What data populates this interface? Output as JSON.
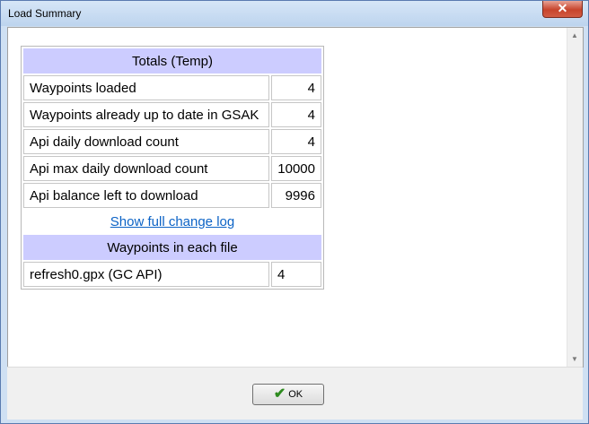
{
  "window": {
    "title": "Load Summary",
    "close_glyph": "✕"
  },
  "totals": {
    "header": "Totals (Temp)",
    "rows": [
      {
        "label": "Waypoints loaded",
        "value": "4"
      },
      {
        "label": "Waypoints already up to date in GSAK",
        "value": "4"
      },
      {
        "label": "Api daily download count",
        "value": "4"
      },
      {
        "label": "Api max daily download count",
        "value": "10000"
      },
      {
        "label": "Api balance left to download",
        "value": "9996"
      }
    ]
  },
  "change_log_link": "Show full change log",
  "files": {
    "header": "Waypoints in each file",
    "rows": [
      {
        "label": "refresh0.gpx (GC API)",
        "value": "4"
      }
    ]
  },
  "footer": {
    "ok_label": "OK",
    "ok_icon": "checkmark-icon"
  },
  "colors": {
    "header_bg": "#ccccff",
    "link": "#0c63c6",
    "check": "#2e8b1f"
  }
}
